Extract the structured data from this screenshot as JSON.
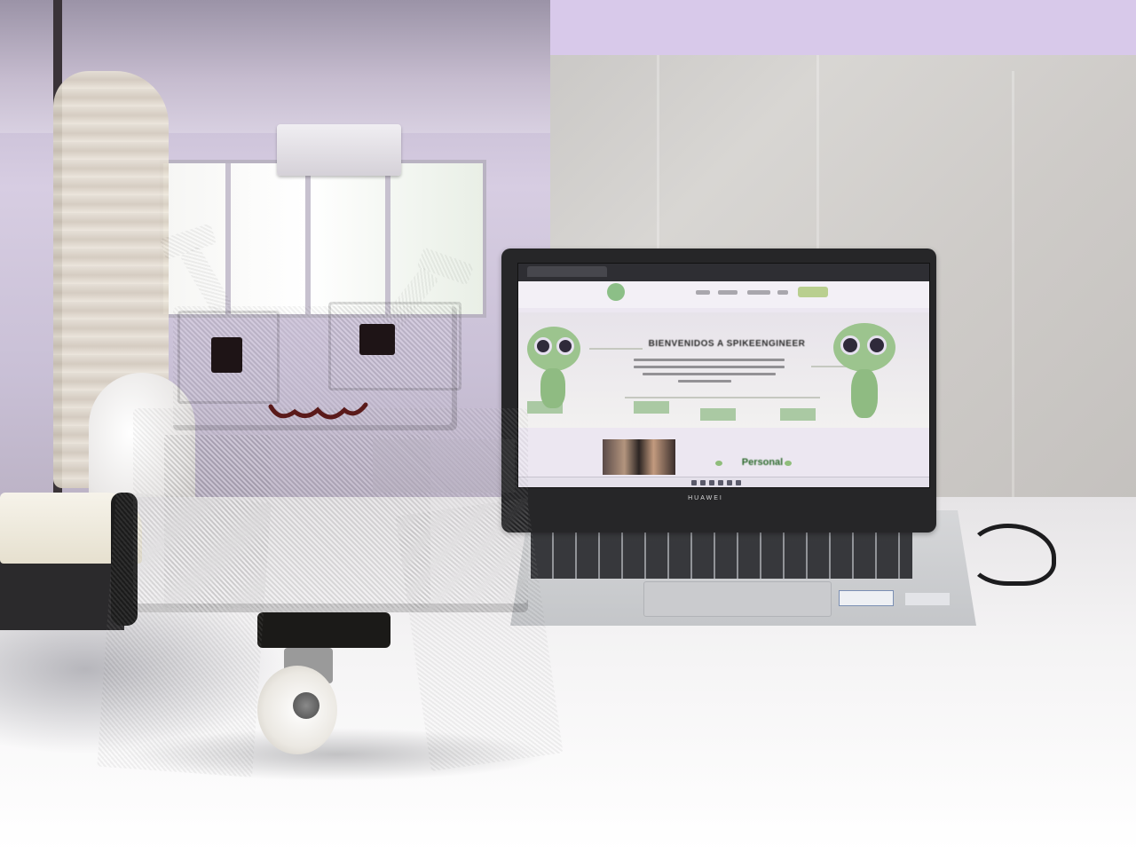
{
  "scene": {
    "description_kind": "photo",
    "colors": {
      "robot_green": "#2c8e58",
      "table_white": "#f4f3f4",
      "wall_gray": "#cecbc8",
      "laptop_dark": "#262628"
    }
  },
  "laptop": {
    "brand": "HUAWEI",
    "screen": {
      "hero_title": "BIENVENIDOS A SPIKEENGINEER",
      "section_heading": "Personal"
    }
  }
}
